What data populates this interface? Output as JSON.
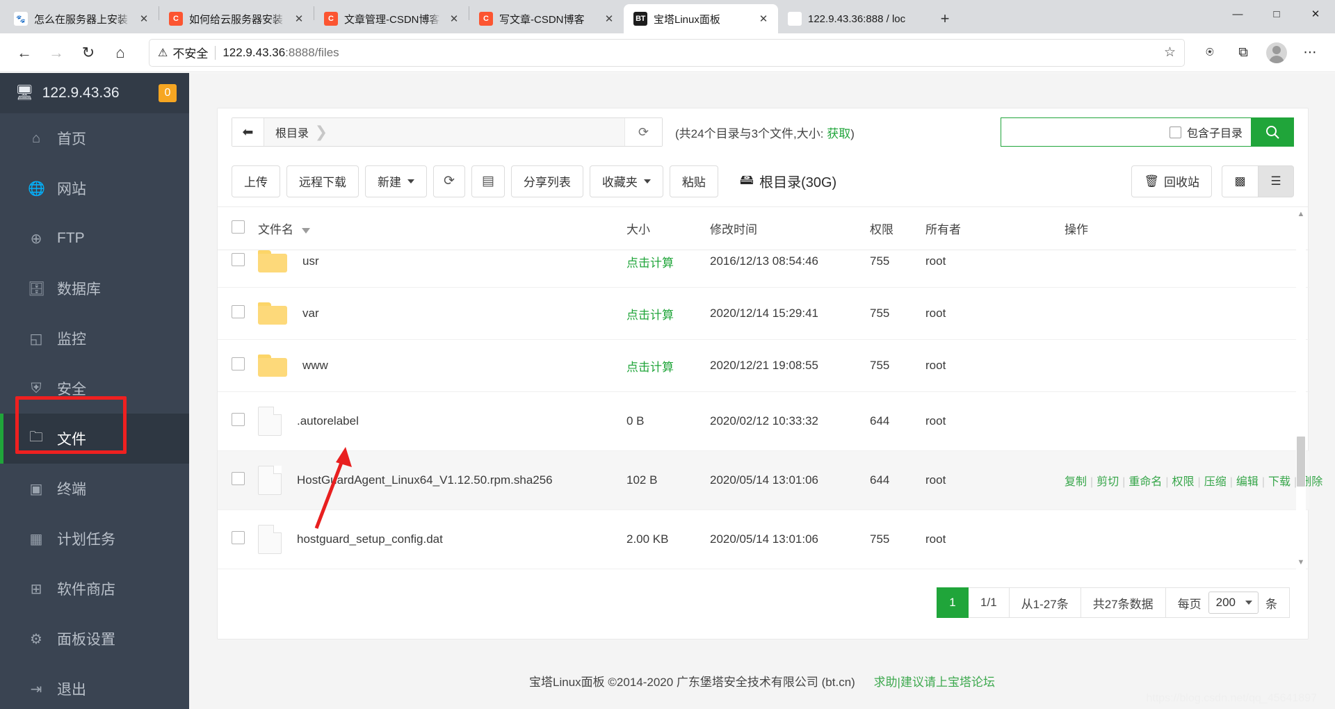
{
  "browser": {
    "tabs": [
      {
        "title": "怎么在服务器上安装",
        "favicon": "baidu-icon",
        "active": false
      },
      {
        "title": "如何给云服务器安装",
        "favicon": "csdn-icon",
        "active": false
      },
      {
        "title": "文章管理-CSDN博客",
        "favicon": "csdn-icon",
        "active": false
      },
      {
        "title": "写文章-CSDN博客",
        "favicon": "csdn-icon",
        "active": false
      },
      {
        "title": "宝塔Linux面板",
        "favicon": "bt-icon",
        "active": true
      },
      {
        "title": "122.9.43.36:888 / loc",
        "favicon": "phpmyadmin-icon",
        "active": false
      }
    ],
    "new_tab_label": "+",
    "window_controls": {
      "minimize": "—",
      "maximize": "□",
      "close": "✕"
    },
    "nav": {
      "back": "←",
      "forward": "→",
      "reload": "↻",
      "home": "⌂",
      "security_label": "不安全",
      "url_host": "122.9.43.36",
      "url_path": ":8888/files",
      "favorite_icon": "star-icon",
      "collections_icon": "collections-icon",
      "favorites_bar_icon": "favorites-icon",
      "profile_icon": "profile-avatar-icon",
      "settings_icon": "more-options-icon"
    }
  },
  "sidebar": {
    "server_ip": "122.9.43.36",
    "notification_count": "0",
    "items": [
      {
        "label": "首页",
        "icon": "home-icon"
      },
      {
        "label": "网站",
        "icon": "globe-icon"
      },
      {
        "label": "FTP",
        "icon": "ftp-icon"
      },
      {
        "label": "数据库",
        "icon": "database-icon"
      },
      {
        "label": "监控",
        "icon": "monitor-chart-icon"
      },
      {
        "label": "安全",
        "icon": "shield-icon"
      },
      {
        "label": "文件",
        "icon": "folder-icon"
      },
      {
        "label": "终端",
        "icon": "terminal-icon"
      },
      {
        "label": "计划任务",
        "icon": "calendar-icon"
      },
      {
        "label": "软件商店",
        "icon": "apps-grid-icon"
      },
      {
        "label": "面板设置",
        "icon": "gear-icon"
      },
      {
        "label": "退出",
        "icon": "logout-icon"
      }
    ],
    "active_index": 6
  },
  "filemanager": {
    "path": {
      "back_icon": "back-arrow-icon",
      "crumb": "根目录",
      "refresh_icon": "refresh-icon"
    },
    "dir_stat_prefix": "(共24个目录与3个文件,大小:",
    "dir_stat_link": "获取",
    "dir_stat_suffix": ")",
    "search": {
      "value": "",
      "placeholder": "",
      "include_sub_label": "包含子目录",
      "include_sub_checked": false,
      "search_icon": "search-icon"
    },
    "toolbar": {
      "upload": "上传",
      "remote_download": "远程下载",
      "new": "新建",
      "refresh_icon": "refresh-icon",
      "terminal_icon": "terminal-icon",
      "share_list": "分享列表",
      "favorites": "收藏夹",
      "paste": "粘贴",
      "disk_icon": "disk-icon",
      "disk_label": "根目录(30G)",
      "recycle_bin": "回收站",
      "recycle_icon": "trash-icon",
      "grid_view_icon": "grid-view-icon",
      "list_view_icon": "list-view-icon"
    },
    "columns": {
      "name": "文件名",
      "size": "大小",
      "mtime": "修改时间",
      "perm": "权限",
      "owner": "所有者",
      "action": "操作"
    },
    "rows": [
      {
        "name": "usr",
        "type": "folder",
        "size": "点击计算",
        "size_is_link": true,
        "mtime": "2016/12/13 08:54:46",
        "perm": "755",
        "owner": "root",
        "hovered": false,
        "partial": true
      },
      {
        "name": "var",
        "type": "folder",
        "size": "点击计算",
        "size_is_link": true,
        "mtime": "2020/12/14 15:29:41",
        "perm": "755",
        "owner": "root",
        "hovered": false,
        "partial": false
      },
      {
        "name": "www",
        "type": "folder",
        "size": "点击计算",
        "size_is_link": true,
        "mtime": "2020/12/21 19:08:55",
        "perm": "755",
        "owner": "root",
        "hovered": false,
        "partial": false
      },
      {
        "name": ".autorelabel",
        "type": "file",
        "size": "0 B",
        "size_is_link": false,
        "mtime": "2020/02/12 10:33:32",
        "perm": "644",
        "owner": "root",
        "hovered": false,
        "partial": false
      },
      {
        "name": "HostGuardAgent_Linux64_V1.12.50.rpm.sha256",
        "type": "file",
        "size": "102 B",
        "size_is_link": false,
        "mtime": "2020/05/14 13:01:06",
        "perm": "644",
        "owner": "root",
        "hovered": true,
        "partial": false
      },
      {
        "name": "hostguard_setup_config.dat",
        "type": "file",
        "size": "2.00 KB",
        "size_is_link": false,
        "mtime": "2020/05/14 13:01:06",
        "perm": "755",
        "owner": "root",
        "hovered": false,
        "partial": false
      }
    ],
    "row_actions": [
      "复制",
      "剪切",
      "重命名",
      "权限",
      "压缩",
      "编辑",
      "下载",
      "删除"
    ],
    "pagination": {
      "current_page": "1",
      "page_of": "1/1",
      "range": "从1-27条",
      "total": "共27条数据",
      "per_page_prefix": "每页",
      "per_page_value": "200",
      "per_page_suffix": "条"
    }
  },
  "footer": {
    "text": "宝塔Linux面板 ©2014-2020 广东堡塔安全技术有限公司 (bt.cn)",
    "forum_link": "求助|建议请上宝塔论坛"
  },
  "watermark": "https://blog.csdn.net/qq_45641897",
  "colors": {
    "accent_green": "#20a53a",
    "sidebar_bg": "#3a4452",
    "annotation_red": "#ef2020",
    "badge_orange": "#f6a622"
  }
}
